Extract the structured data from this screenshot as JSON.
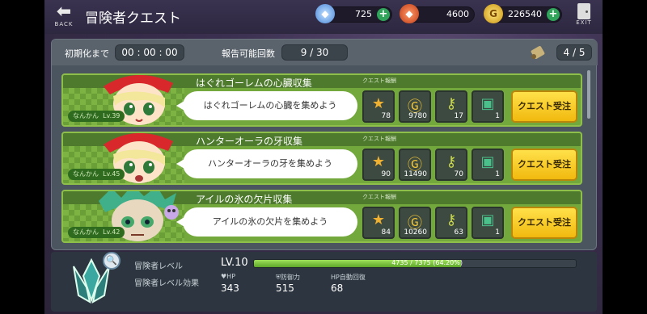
{
  "header": {
    "back_label": "BACK",
    "title": "冒険者クエスト",
    "exit_label": "EXIT",
    "currencies": [
      {
        "icon": "diamond-icon",
        "value": "725",
        "color": "#6ea8f0"
      },
      {
        "icon": "ruby-icon",
        "value": "4600",
        "color": "#e05a2a"
      },
      {
        "icon": "gold-coin-icon",
        "value": "226540",
        "color": "#e8b820"
      }
    ]
  },
  "info": {
    "reset_label": "初期化まで",
    "reset_value": "00 : 00 : 00",
    "report_label": "報告可能回数",
    "report_value": "9 / 30",
    "page_value": "4 / 5"
  },
  "quests": [
    {
      "title": "はぐれゴーレムの心臓収集",
      "reward_label": "クエスト報酬",
      "message": "はぐれゴーレムの心臓を集めよう",
      "npc_name": "なんかん",
      "npc_level": "Lv.39",
      "npc_icon": "elf-girl-red-hat",
      "rewards": [
        "78",
        "9780",
        "17",
        "1"
      ],
      "accept_label": "クエスト受注"
    },
    {
      "title": "ハンターオーラの牙収集",
      "reward_label": "クエスト報酬",
      "message": "ハンターオーラの牙を集めよう",
      "npc_name": "なんかん",
      "npc_level": "Lv.45",
      "npc_icon": "elf-girl-red-hat",
      "rewards": [
        "90",
        "11490",
        "70",
        "1"
      ],
      "accept_label": "クエスト受注"
    },
    {
      "title": "アイルの氷の欠片収集",
      "reward_label": "クエスト報酬",
      "message": "アイルの氷の欠片を集めよう",
      "npc_name": "なんかん",
      "npc_level": "Lv.42",
      "npc_icon": "green-hair-boy",
      "rewards": [
        "84",
        "10260",
        "63",
        "1"
      ],
      "accept_label": "クエスト受注"
    }
  ],
  "reward_icons": [
    "medal-icon",
    "gold-coin-icon",
    "green-key-icon",
    "green-chest-icon"
  ],
  "adventurer": {
    "level_label": "冒険者レベル",
    "level_value": "LV.10",
    "xp_text": "4735 / 7375 (64.20%)",
    "xp_fraction": 0.642,
    "effect_label": "冒険者レベル効果",
    "stats": [
      {
        "label": "HP",
        "value": "343",
        "icon": "heart-icon"
      },
      {
        "label": "防御力",
        "value": "515",
        "icon": "shield-icon"
      },
      {
        "label": "HP自動回復",
        "value": "68",
        "icon": ""
      }
    ]
  }
}
